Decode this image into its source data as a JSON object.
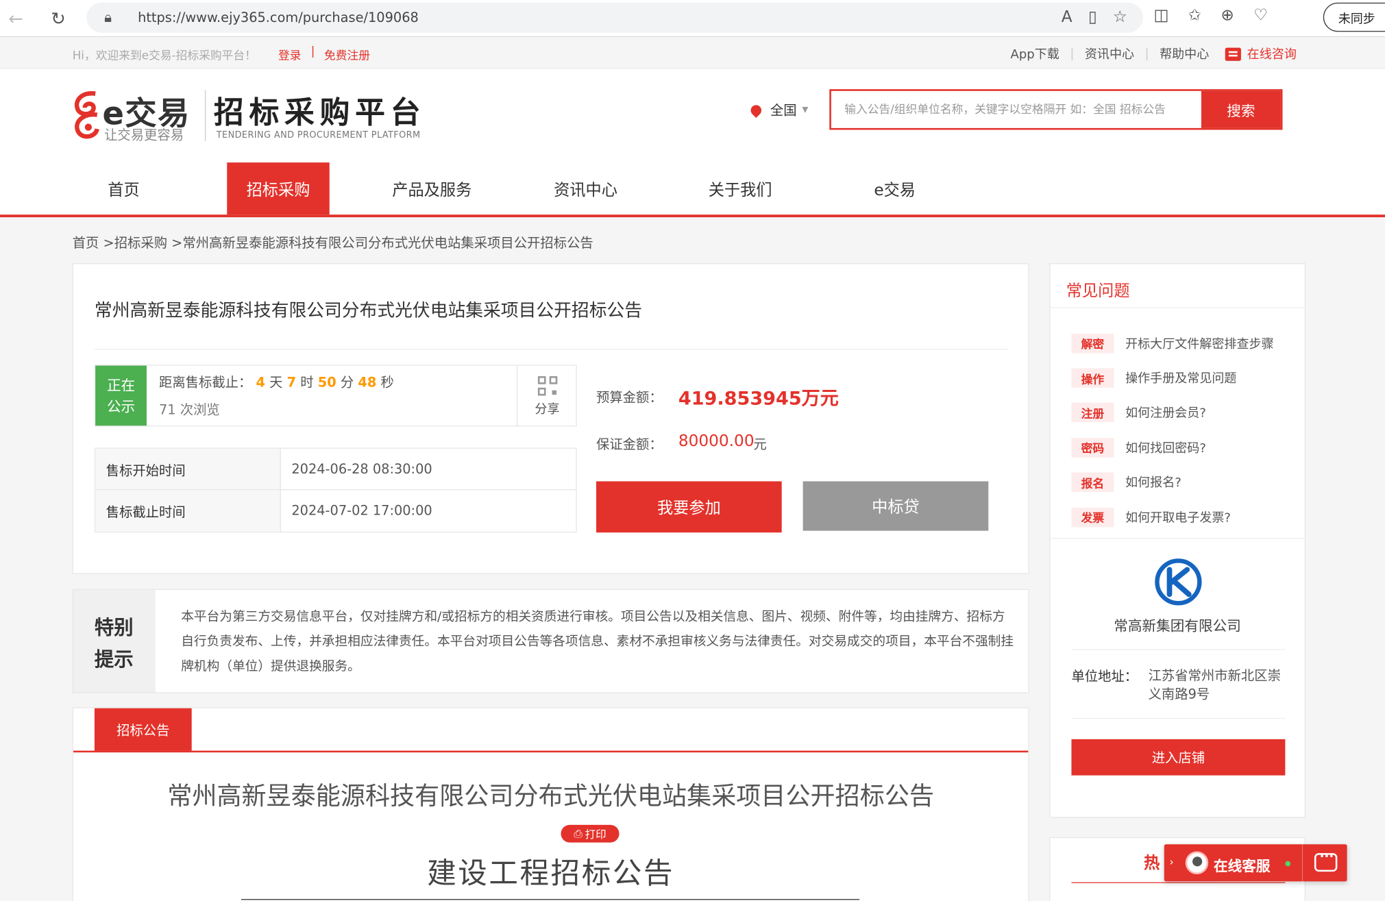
{
  "browser": {
    "url": "https://www.ejy365.com/purchase/109068",
    "sync_label": "未同步"
  },
  "topbar": {
    "welcome": "Hi，欢迎来到e交易-招标采购平台！",
    "login": "登录",
    "separator": "|",
    "register": "免费注册",
    "links": [
      "App下载",
      "资讯中心",
      "帮助中心"
    ],
    "consult": "在线咨询"
  },
  "header": {
    "logo_e": "e交易",
    "logo_slogan": "让交易更容易",
    "logo_title": "招标采购平台",
    "logo_en": "TENDERING AND PROCUREMENT PLATFORM",
    "region": "全国",
    "search_placeholder": "输入公告/组织单位名称，关键字以空格隔开 如：全国 招标公告",
    "search_button": "搜索"
  },
  "nav": {
    "items": [
      "首页",
      "招标采购",
      "产品及服务",
      "资讯中心",
      "关于我们",
      "e交易"
    ],
    "active_index": 1
  },
  "breadcrumb": "首页 >招标采购 >常州高新昱泰能源科技有限公司分布式光伏电站集采项目公开招标公告",
  "project": {
    "title": "常州高新昱泰能源科技有限公司分布式光伏电站集采项目公开招标公告",
    "status": "正在公示",
    "countdown_label": "距离售标截止：",
    "days": "4",
    "hours": "7",
    "minutes": "50",
    "seconds": "48",
    "unit_day": "天",
    "unit_hour": "时",
    "unit_minute": "分",
    "unit_second": "秒",
    "views": "71 次浏览",
    "share": "分享",
    "times": [
      {
        "label": "售标开始时间",
        "value": "2024-06-28 08:30:00"
      },
      {
        "label": "售标截止时间",
        "value": "2024-07-02 17:00:00"
      }
    ],
    "budget_label": "预算金额：",
    "budget_value": "419.853945万元",
    "deposit_label": "保证金额：",
    "deposit_value": "80000.00",
    "deposit_unit": "元",
    "join_button": "我要参加",
    "loan_button": "中标贷"
  },
  "notice": {
    "badge_line1": "特别",
    "badge_line2": "提示",
    "text": "本平台为第三方交易信息平台，仅对挂牌方和/或招标方的相关资质进行审核。项目公告以及相关信息、图片、视频、附件等，均由挂牌方、招标方自行负责发布、上传，并承担相应法律责任。本平台对项目公告等各项信息、素材不承担审核义务与法律责任。对交易成交的项目，本平台不强制挂牌机构（单位）提供退换服务。"
  },
  "announcement": {
    "tab": "招标公告",
    "title": "常州高新昱泰能源科技有限公司分布式光伏电站集采项目公开招标公告",
    "print": "打印",
    "subtitle": "建设工程招标公告"
  },
  "sidebar": {
    "faq_title": "常见问题",
    "faq": [
      {
        "tag": "解密",
        "text": "开标大厅文件解密排查步骤"
      },
      {
        "tag": "操作",
        "text": "操作手册及常见问题"
      },
      {
        "tag": "注册",
        "text": "如何注册会员?"
      },
      {
        "tag": "密码",
        "text": "如何找回密码?"
      },
      {
        "tag": "报名",
        "text": "如何报名?"
      },
      {
        "tag": "发票",
        "text": "如何开取电子发票?"
      }
    ],
    "company_name": "常高新集团有限公司",
    "address_label": "单位地址：",
    "address_value": "江苏省常州市新北区崇义南路9号",
    "shop_button": "进入店铺",
    "hot_title": "热"
  },
  "service": {
    "label": "在线客服"
  },
  "colors": {
    "accent": "#e3322b",
    "status_green": "#4caf50",
    "countdown_orange": "#ff9900"
  }
}
